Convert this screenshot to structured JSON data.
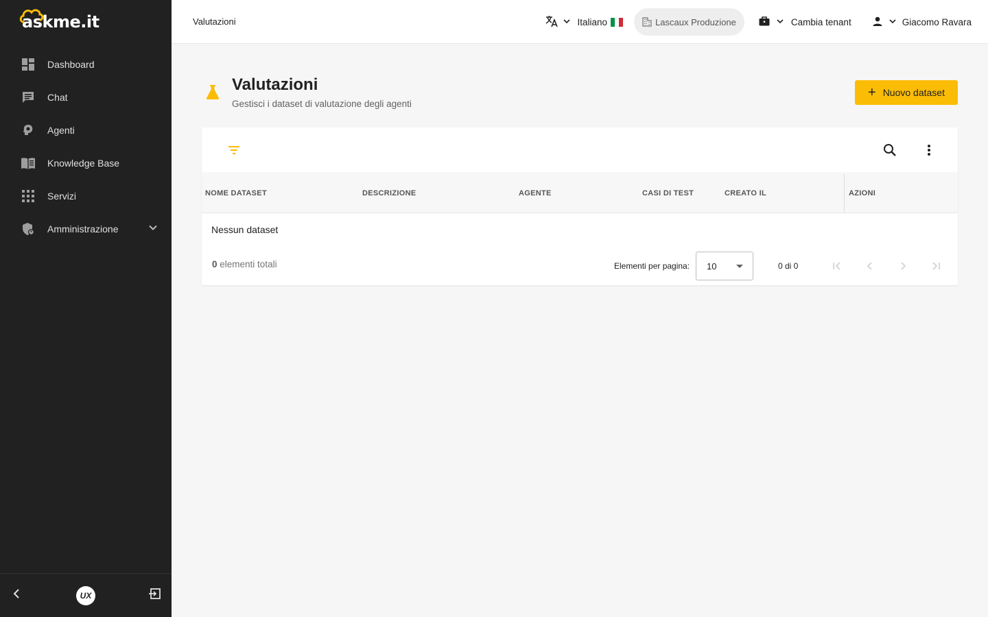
{
  "app": {
    "logo_text": "askme.it",
    "accent_color": "#fbbc05",
    "sidebar_bg": "#212121"
  },
  "sidebar": {
    "items": [
      {
        "label": "Dashboard",
        "icon": "dashboard-icon"
      },
      {
        "label": "Chat",
        "icon": "chat-icon"
      },
      {
        "label": "Agenti",
        "icon": "agent-icon"
      },
      {
        "label": "Knowledge Base",
        "icon": "book-icon"
      },
      {
        "label": "Servizi",
        "icon": "apps-grid-icon"
      },
      {
        "label": "Amministrazione",
        "icon": "admin-shield-icon"
      }
    ],
    "bottom": {
      "badge": "UX"
    }
  },
  "topbar": {
    "breadcrumb": "Valutazioni",
    "language": "Italiano",
    "tenant_current": "Lascaux Produzione",
    "change_tenant": "Cambia tenant",
    "user": "Giacomo Ravara"
  },
  "page": {
    "title": "Valutazioni",
    "subtitle": "Gestisci i dataset di valutazione degli agenti",
    "new_button": "Nuovo dataset"
  },
  "table": {
    "columns": [
      "NOME DATASET",
      "DESCRIZIONE",
      "AGENTE",
      "CASI DI TEST",
      "CREATO IL",
      "AZIONI"
    ],
    "empty_text": "Nessun dataset",
    "total_count": "0",
    "total_label": "elementi totali",
    "per_page_label": "Elementi per pagina:",
    "per_page_value": "10",
    "range_text": "0 di 0"
  }
}
